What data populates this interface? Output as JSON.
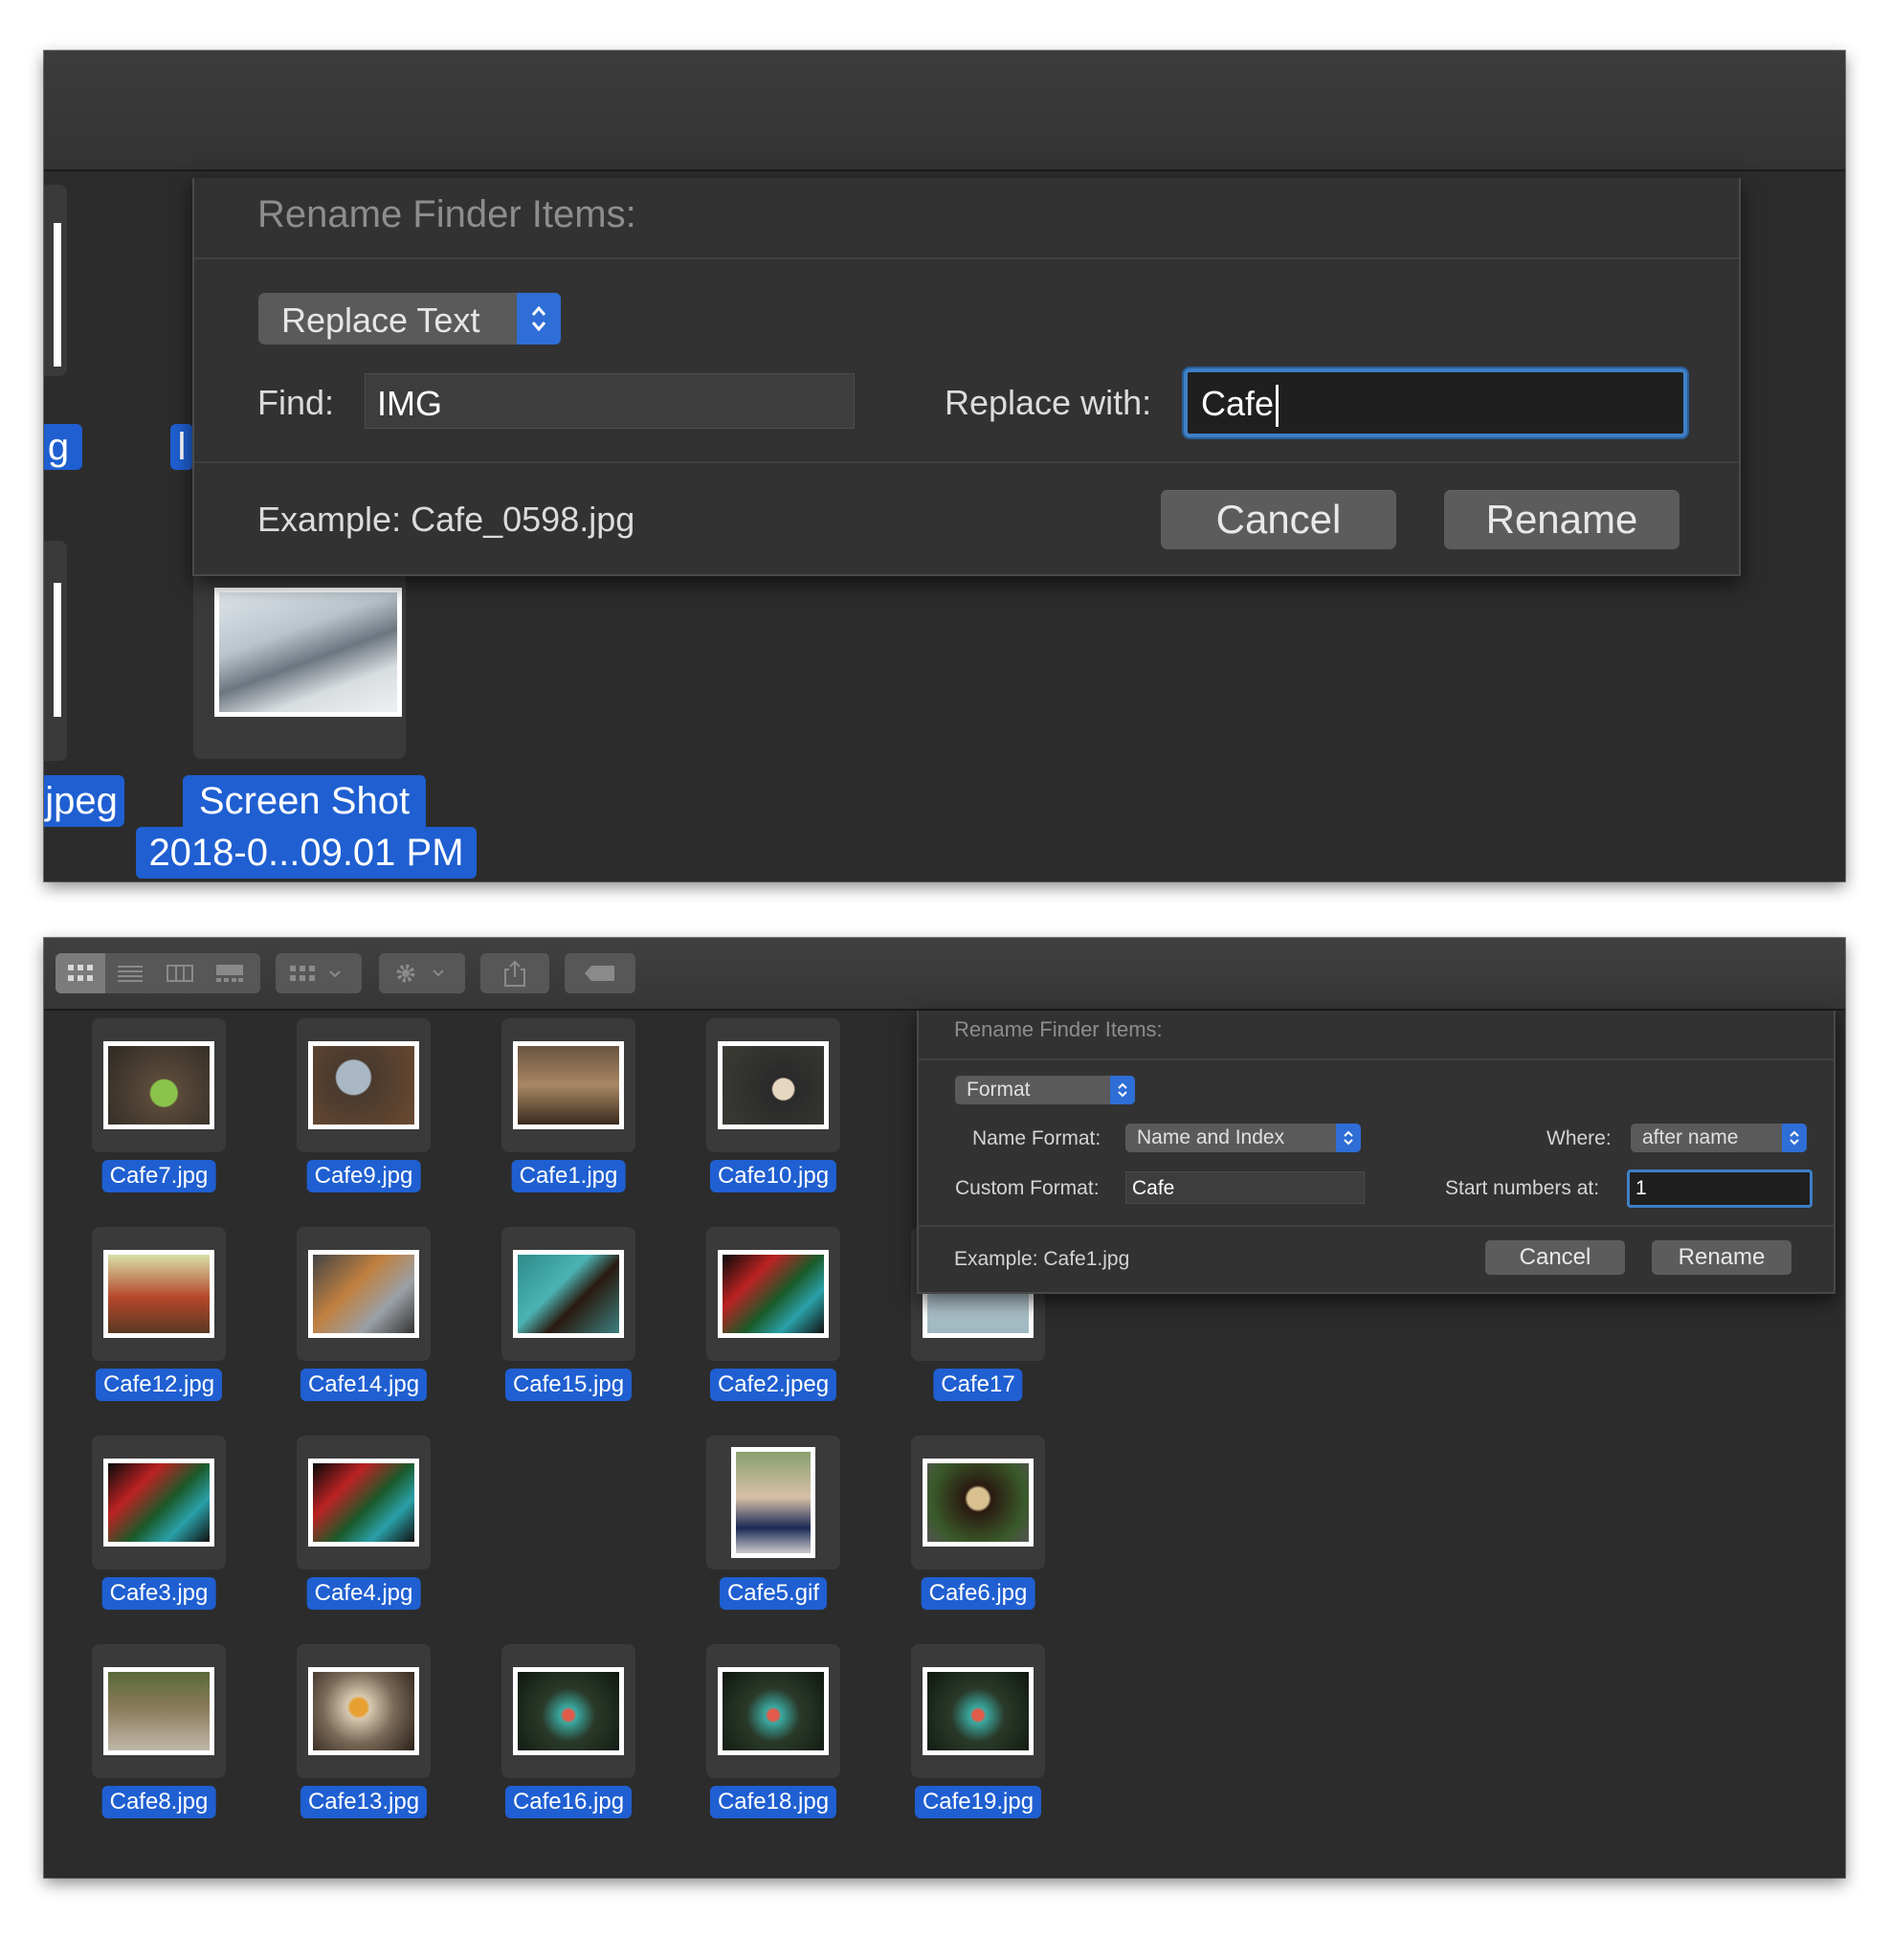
{
  "top": {
    "dialog_title": "Rename Finder Items:",
    "mode": "Replace Text",
    "find_label": "Find:",
    "find_value": "IMG",
    "replace_label": "Replace with:",
    "replace_value": "Cafe",
    "example": "Example: Cafe_0598.jpg",
    "cancel": "Cancel",
    "rename": "Rename",
    "partial_labels": [
      "g",
      "l",
      "jpeg"
    ],
    "file_label_line1": "Screen Shot",
    "file_label_line2": "2018-0...09.01 PM"
  },
  "bottom": {
    "dialog_title": "Rename Finder Items:",
    "mode": "Format",
    "name_format_label": "Name Format:",
    "name_format_value": "Name and Index",
    "where_label": "Where:",
    "where_value": "after name",
    "custom_format_label": "Custom Format:",
    "custom_format_value": "Cafe",
    "start_label": "Start numbers at:",
    "start_value": "1",
    "example": "Example: Cafe1.jpg",
    "cancel": "Cancel",
    "rename": "Rename",
    "files": [
      "Cafe7.jpg",
      "Cafe9.jpg",
      "Cafe1.jpg",
      "Cafe10.jpg",
      "Cafe12.jpg",
      "Cafe14.jpg",
      "Cafe15.jpg",
      "Cafe2.jpeg",
      "Cafe17",
      "Cafe3.jpg",
      "Cafe4.jpg",
      "Cafe5.gif",
      "Cafe6.jpg",
      "Cafe8.jpg",
      "Cafe13.jpg",
      "Cafe16.jpg",
      "Cafe18.jpg",
      "Cafe19.jpg"
    ]
  },
  "colors": {
    "selection": "#1f5fd1",
    "window_bg": "#2c2c2c",
    "focus_ring": "#3e7fc6"
  }
}
